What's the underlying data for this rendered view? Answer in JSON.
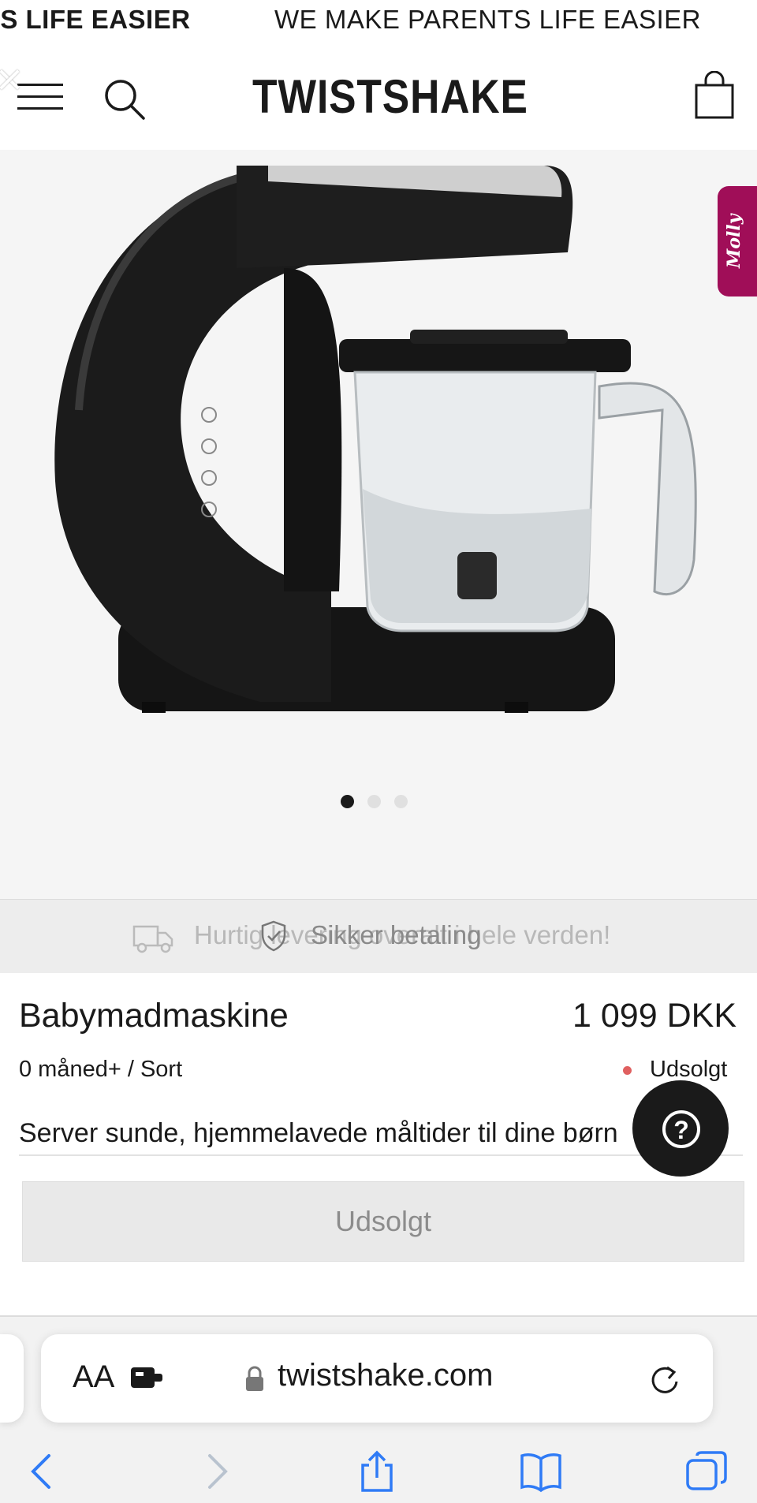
{
  "marquee": {
    "left_text": "'S LIFE EASIER",
    "right_text": "WE MAKE PARENTS LIFE EASIER"
  },
  "header": {
    "logo": "TWISTSHAKE",
    "icons": [
      "close-icon",
      "menu-icon",
      "search-icon",
      "cart-icon"
    ]
  },
  "hero": {
    "carousel": {
      "count": 3,
      "active_index": 0
    },
    "side_badge": "Molly"
  },
  "shipping_strip": {
    "text_faded": "Hurtig levering overalt i hele verden!",
    "text_visible": "Sikker betaling"
  },
  "product": {
    "name": "Babymadmaskine",
    "price": "1 099 DKK",
    "variant": "0 måned+ / Sort",
    "stock_status": "Udsolgt",
    "description": "Server sunde, hjemmelavede måltider til dine børn",
    "button_label": "Udsolgt"
  },
  "help_button": {
    "glyph": "?"
  },
  "browser": {
    "aa_label": "AA",
    "url": "twistshake.com",
    "toolbar": [
      "back-icon",
      "forward-icon",
      "share-icon",
      "bookmarks-icon",
      "tabs-icon"
    ]
  },
  "colors": {
    "badge": "#a00e58",
    "soldout_dot": "#e06060",
    "text": "#1a1a1a"
  }
}
